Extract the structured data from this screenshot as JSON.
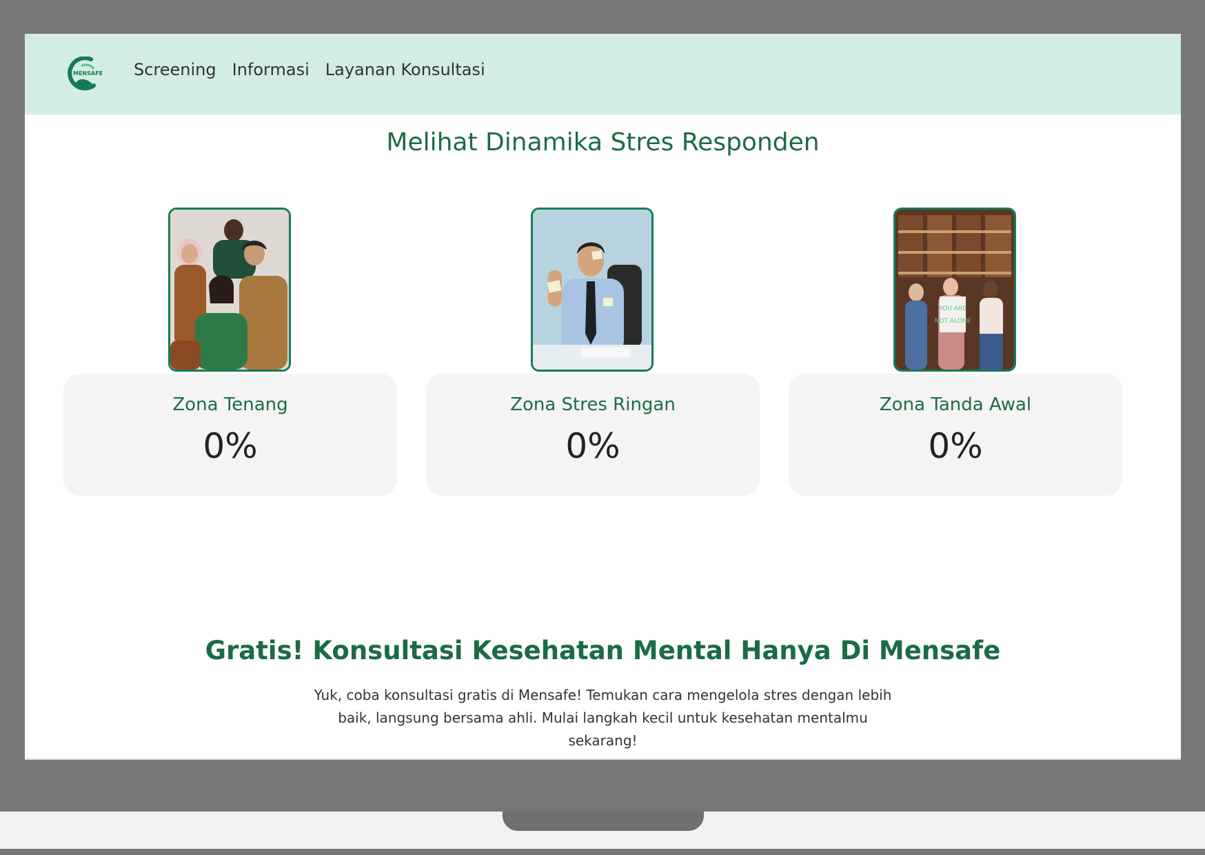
{
  "nav": {
    "logo_text": "MENSAFE",
    "links": [
      "Screening",
      "Informasi",
      "Layanan Konsultasi"
    ]
  },
  "stress_section": {
    "title": "Melihat Dinamika Stres Responden",
    "zones": [
      {
        "label": "Zona Tenang",
        "value": "0%"
      },
      {
        "label": "Zona Stres Ringan",
        "value": "0%"
      },
      {
        "label": "Zona Tanda Awal",
        "value": "0%"
      }
    ]
  },
  "promo": {
    "title_emphasis": "Gratis!",
    "title_rest": " Konsultasi Kesehatan Mental Hanya Di Mensafe",
    "description": "Yuk, coba konsultasi gratis di Mensafe! Temukan cara mengelola stres dengan lebih baik, langsung bersama ahli. Mulai langkah kecil untuk kesehatan mentalmu sekarang!"
  },
  "colors": {
    "navbar_bg": "#d3ede3",
    "brand_green": "#1c6b45",
    "photo_border": "#157a55",
    "card_bg": "#f4f4f4"
  }
}
